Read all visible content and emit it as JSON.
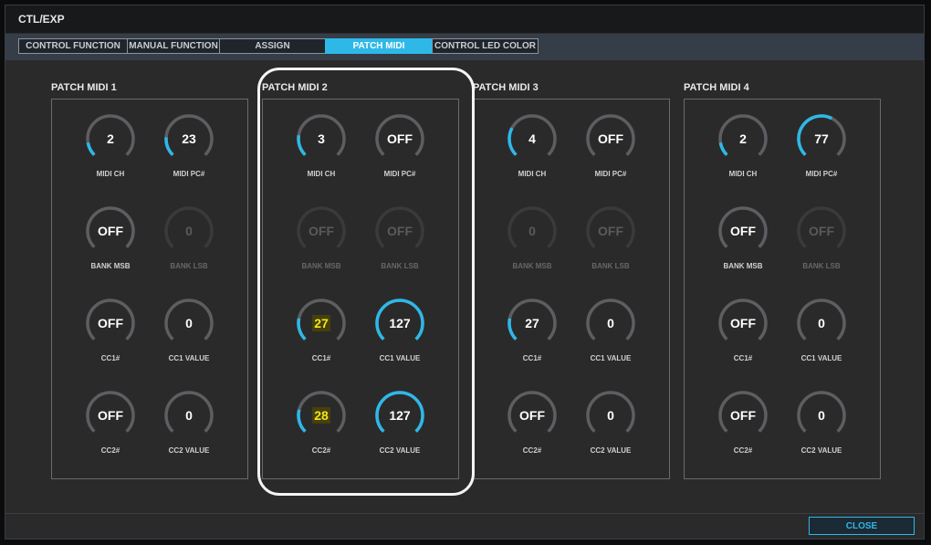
{
  "window": {
    "title": "CTL/EXP"
  },
  "tabs": [
    {
      "label": "CONTROL FUNCTION",
      "active": false
    },
    {
      "label": "MANUAL FUNCTION",
      "active": false
    },
    {
      "label": "ASSIGN",
      "active": false
    },
    {
      "label": "PATCH MIDI",
      "active": true
    },
    {
      "label": "CONTROL LED COLOR",
      "active": false
    }
  ],
  "groups": [
    {
      "title": "PATCH MIDI 1",
      "knobs": [
        {
          "label": "MIDI CH",
          "value": "2",
          "level": 0.13,
          "enabled": true
        },
        {
          "label": "MIDI PC#",
          "value": "23",
          "level": 0.18,
          "enabled": true
        },
        {
          "label": "BANK MSB",
          "value": "OFF",
          "level": 0,
          "enabled": true
        },
        {
          "label": "BANK LSB",
          "value": "0",
          "level": 0,
          "enabled": false
        },
        {
          "label": "CC1#",
          "value": "OFF",
          "level": 0,
          "enabled": true
        },
        {
          "label": "CC1 VALUE",
          "value": "0",
          "level": 0,
          "enabled": true
        },
        {
          "label": "CC2#",
          "value": "OFF",
          "level": 0,
          "enabled": true
        },
        {
          "label": "CC2 VALUE",
          "value": "0",
          "level": 0,
          "enabled": true
        }
      ]
    },
    {
      "title": "PATCH MIDI 2",
      "knobs": [
        {
          "label": "MIDI CH",
          "value": "3",
          "level": 0.2,
          "enabled": true
        },
        {
          "label": "MIDI PC#",
          "value": "OFF",
          "level": 0,
          "enabled": true
        },
        {
          "label": "BANK MSB",
          "value": "OFF",
          "level": 0,
          "enabled": false
        },
        {
          "label": "BANK LSB",
          "value": "OFF",
          "level": 0,
          "enabled": false
        },
        {
          "label": "CC1#",
          "value": "27",
          "level": 0.21,
          "enabled": true,
          "highlight": true
        },
        {
          "label": "CC1 VALUE",
          "value": "127",
          "level": 1,
          "enabled": true
        },
        {
          "label": "CC2#",
          "value": "28",
          "level": 0.22,
          "enabled": true,
          "highlight": true
        },
        {
          "label": "CC2 VALUE",
          "value": "127",
          "level": 1,
          "enabled": true
        }
      ]
    },
    {
      "title": "PATCH MIDI 3",
      "knobs": [
        {
          "label": "MIDI CH",
          "value": "4",
          "level": 0.27,
          "enabled": true
        },
        {
          "label": "MIDI PC#",
          "value": "OFF",
          "level": 0,
          "enabled": true
        },
        {
          "label": "BANK MSB",
          "value": "0",
          "level": 0,
          "enabled": false
        },
        {
          "label": "BANK LSB",
          "value": "OFF",
          "level": 0,
          "enabled": false
        },
        {
          "label": "CC1#",
          "value": "27",
          "level": 0.21,
          "enabled": true
        },
        {
          "label": "CC1 VALUE",
          "value": "0",
          "level": 0,
          "enabled": true
        },
        {
          "label": "CC2#",
          "value": "OFF",
          "level": 0,
          "enabled": true
        },
        {
          "label": "CC2 VALUE",
          "value": "0",
          "level": 0,
          "enabled": true
        }
      ]
    },
    {
      "title": "PATCH MIDI 4",
      "knobs": [
        {
          "label": "MIDI CH",
          "value": "2",
          "level": 0.13,
          "enabled": true
        },
        {
          "label": "MIDI PC#",
          "value": "77",
          "level": 0.6,
          "enabled": true
        },
        {
          "label": "BANK MSB",
          "value": "OFF",
          "level": 0,
          "enabled": true
        },
        {
          "label": "BANK LSB",
          "value": "OFF",
          "level": 0,
          "enabled": false
        },
        {
          "label": "CC1#",
          "value": "OFF",
          "level": 0,
          "enabled": true
        },
        {
          "label": "CC1 VALUE",
          "value": "0",
          "level": 0,
          "enabled": true
        },
        {
          "label": "CC2#",
          "value": "OFF",
          "level": 0,
          "enabled": true
        },
        {
          "label": "CC2 VALUE",
          "value": "0",
          "level": 0,
          "enabled": true
        }
      ]
    }
  ],
  "footer": {
    "close_label": "CLOSE"
  },
  "colors": {
    "accent": "#2eb8e8",
    "track": "#5e5e62",
    "track_disabled": "#3a3a3d",
    "highlight_text": "#f2e51a"
  }
}
